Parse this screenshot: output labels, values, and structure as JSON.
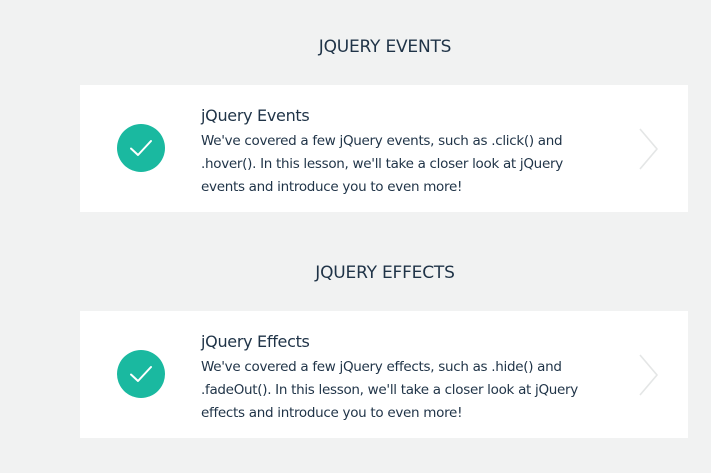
{
  "sections": [
    {
      "heading": "JQUERY EVENTS",
      "lesson": {
        "title": "jQuery Events",
        "description": "We've covered a few jQuery events, such as .click() and .hover(). In this lesson, we'll take a closer look at jQuery events and introduce you to even more!",
        "status_icon": "checkmark-icon",
        "nav_icon": "chevron-right-icon"
      }
    },
    {
      "heading": "JQUERY EFFECTS",
      "lesson": {
        "title": "jQuery Effects",
        "description": "We've covered a few jQuery effects, such as .hide() and .fadeOut(). In this lesson, we'll take a closer look at jQuery effects and introduce you to even more!",
        "status_icon": "checkmark-icon",
        "nav_icon": "chevron-right-icon"
      }
    }
  ],
  "colors": {
    "background": "#f1f2f2",
    "card": "#ffffff",
    "accent": "#1ab9a0",
    "text": "#1f3347",
    "chevron": "#e4e6e6"
  }
}
